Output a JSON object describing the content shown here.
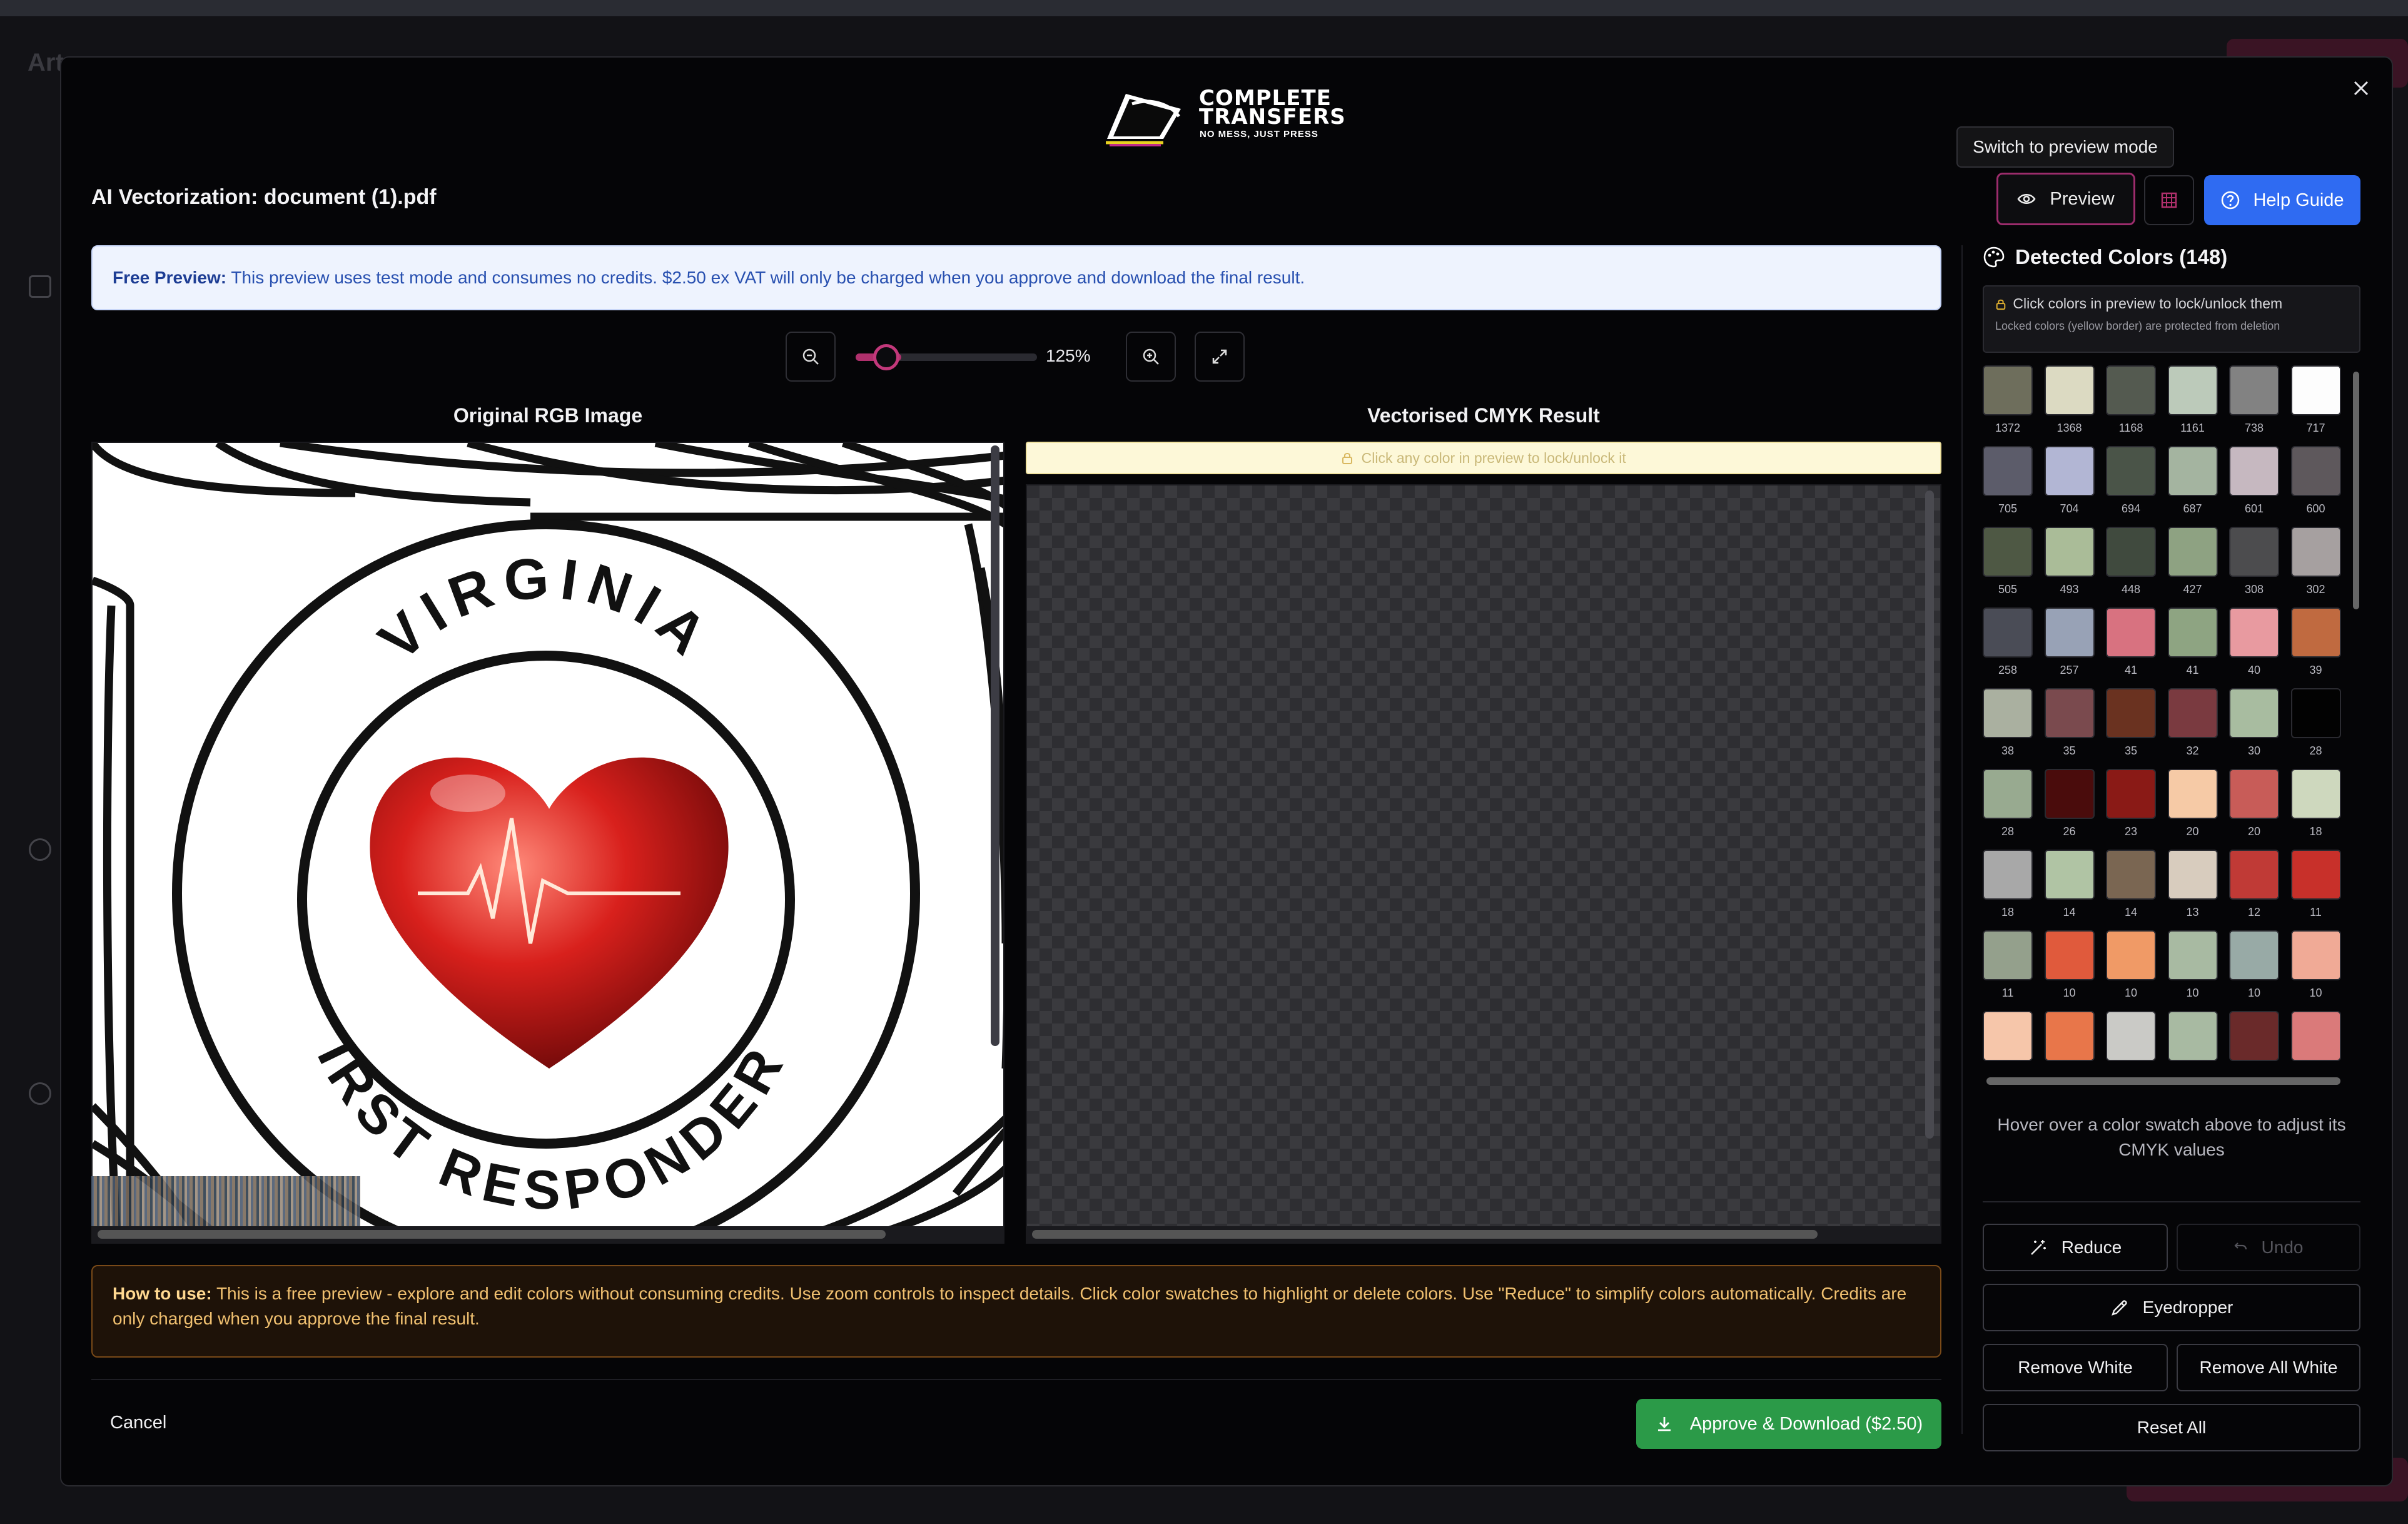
{
  "modal": {
    "logo": {
      "line1": "COMPLETE",
      "line2": "TRANSFERS",
      "tagline": "NO MESS, JUST PRESS"
    },
    "title": "AI Vectorization: document (1).pdf",
    "tooltip": "Switch to preview mode",
    "preview_label": "Preview",
    "help_label": "Help Guide",
    "close_icon": "close-icon"
  },
  "banner": {
    "bold": "Free Preview:",
    "text": " This preview uses test mode and consumes no credits. $2.50 ex VAT will only be charged when you approve and download the final result."
  },
  "zoom": {
    "value": "125%",
    "level": 0.25
  },
  "panes": {
    "left_title": "Original RGB Image",
    "right_title": "Vectorised CMYK Result",
    "lock_hint": "Click any color in preview to lock/unlock it",
    "image_text_top": "VIRGINIA",
    "image_text_bottom": "FIRST RESPONDERS"
  },
  "howto": {
    "bold": "How to use:",
    "text": " This is a free preview - explore and edit colors without consuming credits. Use zoom controls to inspect details. Click color swatches to highlight or delete colors. Use \"Reduce\" to simplify colors automatically. Credits are only charged when you approve the final result."
  },
  "footer": {
    "cancel": "Cancel",
    "approve": "Approve & Download ($2.50)"
  },
  "colors_panel": {
    "title": "Detected Colors (148)",
    "hint_line1": "Click colors in preview to lock/unlock them",
    "hint_line2": "Locked colors (yellow border) are protected from deletion",
    "hover_hint": "Hover over a color swatch above to adjust its CMYK values",
    "swatches": [
      {
        "color": "#6e6e5c",
        "count": "1372"
      },
      {
        "color": "#dcdac2",
        "count": "1368"
      },
      {
        "color": "#545a50",
        "count": "1168"
      },
      {
        "color": "#bccaba",
        "count": "1161"
      },
      {
        "color": "#828282",
        "count": "738"
      },
      {
        "color": "#fdfdfd",
        "count": "717"
      },
      {
        "color": "#5c5c6a",
        "count": "705"
      },
      {
        "color": "#b2b6d4",
        "count": "704"
      },
      {
        "color": "#4a5448",
        "count": "694"
      },
      {
        "color": "#a4b4a0",
        "count": "687"
      },
      {
        "color": "#c6b8c0",
        "count": "601"
      },
      {
        "color": "#5e585c",
        "count": "600"
      },
      {
        "color": "#4e5844",
        "count": "505"
      },
      {
        "color": "#aabc98",
        "count": "493"
      },
      {
        "color": "#404a3e",
        "count": "448"
      },
      {
        "color": "#8ea282",
        "count": "427"
      },
      {
        "color": "#4c4c4e",
        "count": "308"
      },
      {
        "color": "#a6a0a0",
        "count": "302"
      },
      {
        "color": "#4a4c56",
        "count": "258"
      },
      {
        "color": "#98a2b6",
        "count": "257"
      },
      {
        "color": "#d87280",
        "count": "41"
      },
      {
        "color": "#8ea482",
        "count": "41"
      },
      {
        "color": "#e89aa0",
        "count": "40"
      },
      {
        "color": "#c06a40",
        "count": "39"
      },
      {
        "color": "#aab0a0",
        "count": "38"
      },
      {
        "color": "#7a4a4e",
        "count": "35"
      },
      {
        "color": "#6a3220",
        "count": "35"
      },
      {
        "color": "#7a3a40",
        "count": "32"
      },
      {
        "color": "#a8bca0",
        "count": "30"
      },
      {
        "color": "#020202",
        "count": "28"
      },
      {
        "color": "#98aa90",
        "count": "28"
      },
      {
        "color": "#4a0c0c",
        "count": "26"
      },
      {
        "color": "#8a1a16",
        "count": "23"
      },
      {
        "color": "#f6caa6",
        "count": "20"
      },
      {
        "color": "#c85c58",
        "count": "20"
      },
      {
        "color": "#ced8be",
        "count": "18"
      },
      {
        "color": "#a8a8a8",
        "count": "18"
      },
      {
        "color": "#b0c4a4",
        "count": "14"
      },
      {
        "color": "#7a6652",
        "count": "14"
      },
      {
        "color": "#d8ccbe",
        "count": "13"
      },
      {
        "color": "#c03a36",
        "count": "12"
      },
      {
        "color": "#c8302a",
        "count": "11"
      },
      {
        "color": "#94a08c",
        "count": "11"
      },
      {
        "color": "#e05a3c",
        "count": "10"
      },
      {
        "color": "#f09a66",
        "count": "10"
      },
      {
        "color": "#a8baa2",
        "count": "10"
      },
      {
        "color": "#98aaa6",
        "count": "10"
      },
      {
        "color": "#f0aa96",
        "count": "10"
      },
      {
        "color": "#f6c6aa",
        "count": ""
      },
      {
        "color": "#e8764a",
        "count": ""
      },
      {
        "color": "#cacac6",
        "count": ""
      },
      {
        "color": "#a8baa2",
        "count": ""
      },
      {
        "color": "#6a2a2a",
        "count": ""
      },
      {
        "color": "#da7a7a",
        "count": ""
      }
    ]
  },
  "tools": {
    "reduce": "Reduce",
    "undo": "Undo",
    "eyedropper": "Eyedropper",
    "remove_white": "Remove White",
    "remove_all_white": "Remove All White",
    "reset_all": "Reset All"
  },
  "background_app": {
    "title": "Art"
  }
}
